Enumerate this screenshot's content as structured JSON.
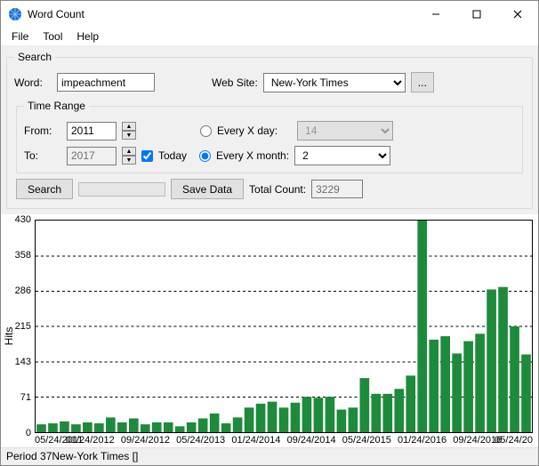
{
  "window": {
    "title": "Word Count"
  },
  "menu": [
    "File",
    "Tool",
    "Help"
  ],
  "search_group": {
    "legend": "Search",
    "word_label": "Word:",
    "word_value": "impeachment",
    "website_label": "Web Site:",
    "website_value": "New-York Times",
    "ellipsis": "..."
  },
  "time_group": {
    "legend": "Time Range",
    "from_label": "From:",
    "from_value": "2011",
    "to_label": "To:",
    "to_value": "2017",
    "today_label": "Today",
    "today_checked": true,
    "every_day_label": "Every X day:",
    "every_day_value": "14",
    "every_month_label": "Every X month:",
    "every_month_value": "2",
    "mode": "month"
  },
  "actions": {
    "search": "Search",
    "save": "Save Data",
    "total_label": "Total Count:",
    "total_value": "3229"
  },
  "chart_data": {
    "type": "bar",
    "title": "",
    "xlabel": "",
    "ylabel": "Hits",
    "ylim": [
      0,
      430
    ],
    "yticks": [
      0,
      71,
      143,
      215,
      286,
      358,
      430
    ],
    "xticks": [
      "05/24/2011",
      "01/24/2012",
      "09/24/2012",
      "05/24/2013",
      "01/24/2014",
      "09/24/2014",
      "05/24/2015",
      "01/24/2016",
      "09/24/2016",
      "05/24/20"
    ],
    "series": [
      {
        "name": "New-York Times",
        "values": [
          16,
          18,
          22,
          16,
          20,
          18,
          30,
          20,
          28,
          16,
          20,
          20,
          12,
          20,
          28,
          38,
          18,
          30,
          50,
          58,
          62,
          50,
          60,
          72,
          70,
          72,
          46,
          50,
          110,
          78,
          78,
          88,
          115,
          430,
          188,
          195,
          160,
          185,
          200,
          290,
          295,
          215,
          158
        ]
      }
    ]
  },
  "status": "Period 37New-York Times []"
}
